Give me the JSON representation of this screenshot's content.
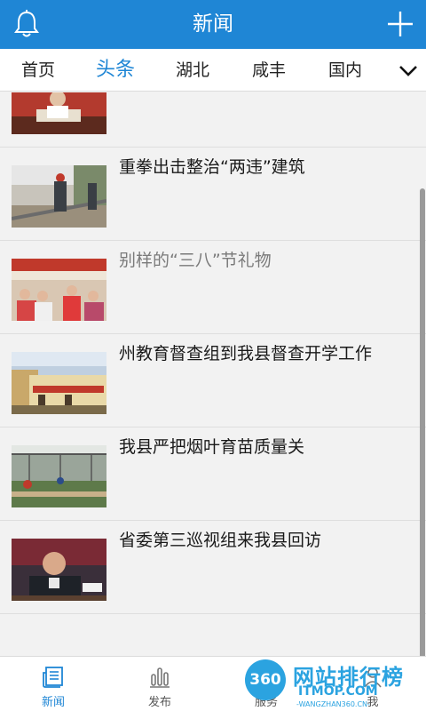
{
  "header": {
    "title": "新闻",
    "left_icon": "bell-icon",
    "right_icon": "plus-icon"
  },
  "tabs": [
    {
      "label": "首页",
      "active": false
    },
    {
      "label": "头条",
      "active": true
    },
    {
      "label": "湖北",
      "active": false
    },
    {
      "label": "咸丰",
      "active": false
    },
    {
      "label": "国内",
      "active": false
    }
  ],
  "tabs_more_icon": "chevron-down-icon",
  "news": [
    {
      "title": "",
      "read": false
    },
    {
      "title": "重拳出击整治“两违”建筑",
      "read": false
    },
    {
      "title": "别样的“三八”节礼物",
      "read": true
    },
    {
      "title": "州教育督查组到我县督查开学工作",
      "read": false
    },
    {
      "title": "我县严把烟叶育苗质量关",
      "read": false
    },
    {
      "title": "省委第三巡视组来我县回访",
      "read": false
    }
  ],
  "bottom_nav": [
    {
      "label": "新闻",
      "icon": "newspaper-icon",
      "active": true
    },
    {
      "label": "发布",
      "icon": "bar-chart-icon",
      "active": false
    },
    {
      "label": "服务",
      "icon": "service-icon",
      "active": false
    },
    {
      "label": "我",
      "icon": "user-icon",
      "active": false
    }
  ],
  "watermark": {
    "logo": "360",
    "name": "网站排行榜",
    "site": "ITMOP.COM",
    "url": "-WANGZHAN360.CN-"
  },
  "colors": {
    "primary": "#1f86d5",
    "read_text": "#7a7a7a",
    "background": "#f2f2f2"
  }
}
